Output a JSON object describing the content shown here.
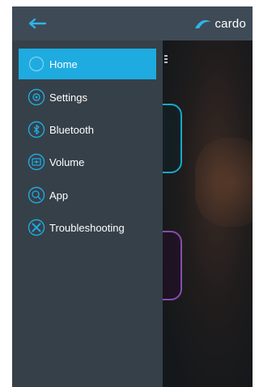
{
  "header": {
    "back_icon": "arrow-left-icon",
    "brand": "cardo"
  },
  "menu": {
    "items": [
      {
        "label": "Home",
        "icon": "home-icon",
        "active": true
      },
      {
        "label": "Settings",
        "icon": "settings-icon",
        "active": false
      },
      {
        "label": "Bluetooth",
        "icon": "bluetooth-icon",
        "active": false
      },
      {
        "label": "Volume",
        "icon": "volume-icon",
        "active": false
      },
      {
        "label": "App",
        "icon": "app-icon",
        "active": false
      },
      {
        "label": "Troubleshooting",
        "icon": "troubleshooting-icon",
        "active": false
      }
    ]
  },
  "colors": {
    "accent": "#1eabe0",
    "drawer": "#364049",
    "header": "#3e4a56"
  }
}
